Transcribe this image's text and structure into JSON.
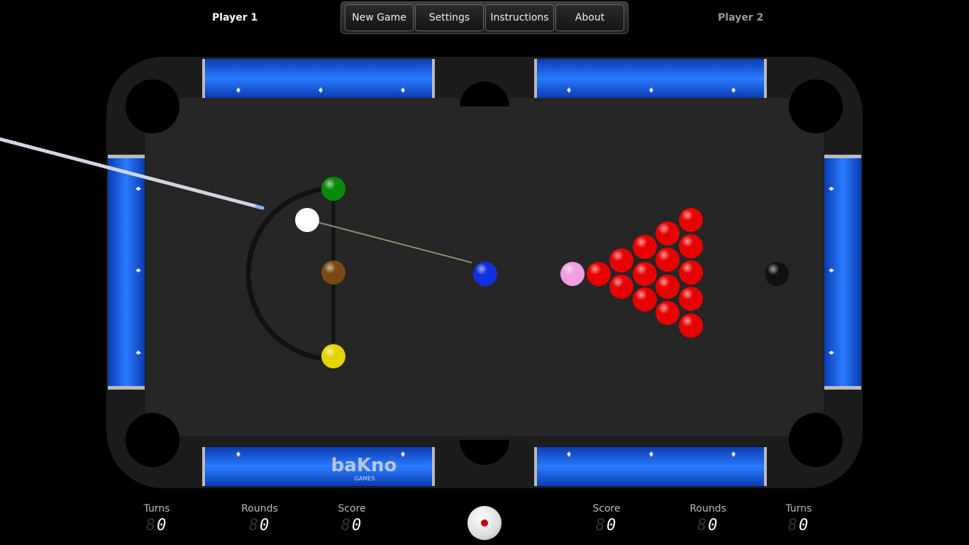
{
  "players": {
    "p1": "Player 1",
    "p2": "Player 2"
  },
  "menu": [
    {
      "label": "New Game"
    },
    {
      "label": "Settings"
    },
    {
      "label": "Instructions"
    },
    {
      "label": "About"
    }
  ],
  "logo": {
    "text": "baKno",
    "subtext": "GAMES"
  },
  "stats": {
    "p1": {
      "turns": {
        "label": "Turns",
        "value": "0"
      },
      "rounds": {
        "label": "Rounds",
        "value": "0"
      },
      "score": {
        "label": "Score",
        "value": "0"
      }
    },
    "p2": {
      "score": {
        "label": "Score",
        "value": "0"
      },
      "rounds": {
        "label": "Rounds",
        "value": "0"
      },
      "turns": {
        "label": "Turns",
        "value": "0"
      }
    }
  },
  "colors": {
    "felt": "#262626",
    "rail": "#1f6fe0",
    "red": "#e80000",
    "green": "#0a8a0a",
    "brown": "#7a4a14",
    "yellow": "#e6d400",
    "blue": "#1030e0",
    "pink": "#f0a0e0",
    "black": "#111111",
    "cue": "#ffffff"
  }
}
